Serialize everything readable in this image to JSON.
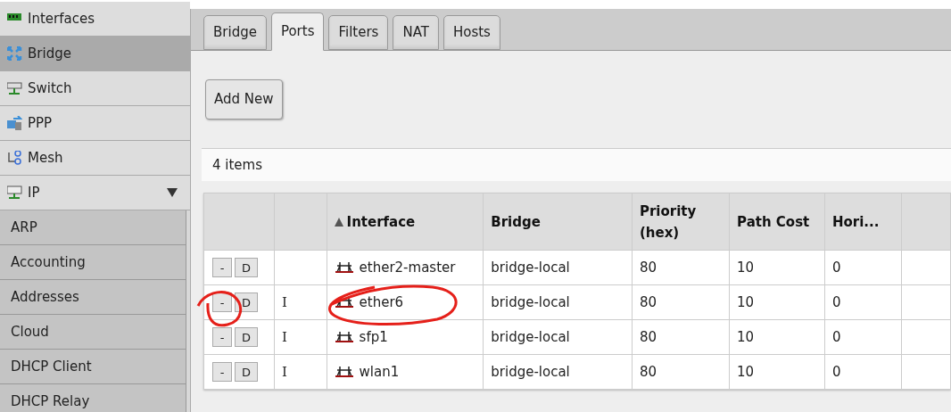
{
  "sidebar": {
    "items": [
      {
        "label": "Interfaces",
        "selected": false
      },
      {
        "label": "Bridge",
        "selected": true
      },
      {
        "label": "Switch",
        "selected": false
      },
      {
        "label": "PPP",
        "selected": false
      },
      {
        "label": "Mesh",
        "selected": false
      },
      {
        "label": "IP",
        "selected": false,
        "expanded": true,
        "children": [
          {
            "label": "ARP",
            "selected": false
          },
          {
            "label": "Accounting",
            "selected": false
          },
          {
            "label": "Addresses",
            "selected": false
          },
          {
            "label": "Cloud",
            "selected": false
          },
          {
            "label": "DHCP Client",
            "selected": false
          },
          {
            "label": "DHCP Relay",
            "selected": false
          }
        ]
      }
    ]
  },
  "tabs": [
    {
      "label": "Bridge",
      "selected": false
    },
    {
      "label": "Ports",
      "selected": true
    },
    {
      "label": "Filters",
      "selected": false
    },
    {
      "label": "NAT",
      "selected": false
    },
    {
      "label": "Hosts",
      "selected": false
    }
  ],
  "add_button": "Add New",
  "item_count": "4 items",
  "table": {
    "columns": [
      {
        "label": "Interface",
        "sorted": true
      },
      {
        "label": "Bridge",
        "sorted": false
      },
      {
        "label": "Priority (hex)",
        "sorted": false
      },
      {
        "label": "Path Cost",
        "sorted": false
      },
      {
        "label": "Hori...",
        "sorted": false
      }
    ],
    "rows": [
      {
        "remove": "-",
        "disable": "D",
        "interface": "ether2-master",
        "bridge": "bridge-local",
        "priority": "80",
        "path_cost": "10",
        "horizon": "0"
      },
      {
        "remove": "-",
        "disable": "D",
        "flag": "I",
        "interface": "ether6",
        "bridge": "bridge-local",
        "priority": "80",
        "path_cost": "10",
        "horizon": "0"
      },
      {
        "remove": "-",
        "disable": "D",
        "flag": "I",
        "interface": "sfp1",
        "bridge": "bridge-local",
        "priority": "80",
        "path_cost": "10",
        "horizon": "0"
      },
      {
        "remove": "-",
        "disable": "D",
        "flag": "I",
        "interface": "wlan1",
        "bridge": "bridge-local",
        "priority": "80",
        "path_cost": "10",
        "horizon": "0"
      }
    ]
  }
}
